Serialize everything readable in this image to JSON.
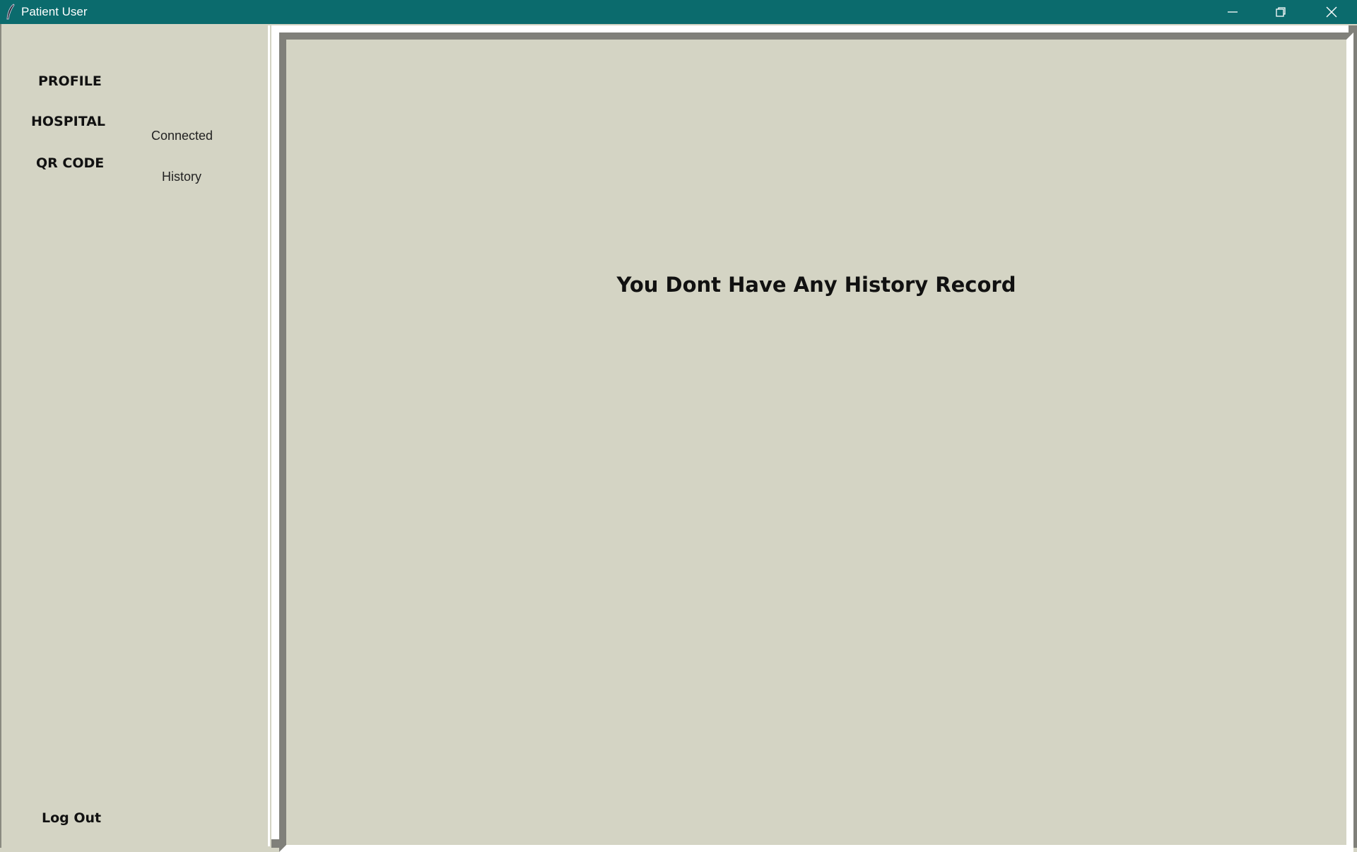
{
  "window": {
    "title": "Patient User",
    "titlebar_color": "#0b6b6d",
    "controls": [
      "minimize-icon",
      "restore-icon",
      "close-icon"
    ]
  },
  "sidebar": {
    "profile_label": "PROFILE",
    "hospital_label": "HOSPITAL",
    "connected_label": "Connected",
    "qr_code_label": "QR CODE",
    "history_label": "History",
    "logout_label": "Log Out"
  },
  "main": {
    "empty_message": "You Dont Have Any History Record"
  },
  "colors": {
    "background": "#d4d4c4",
    "frame_shadow": "#80807a"
  }
}
